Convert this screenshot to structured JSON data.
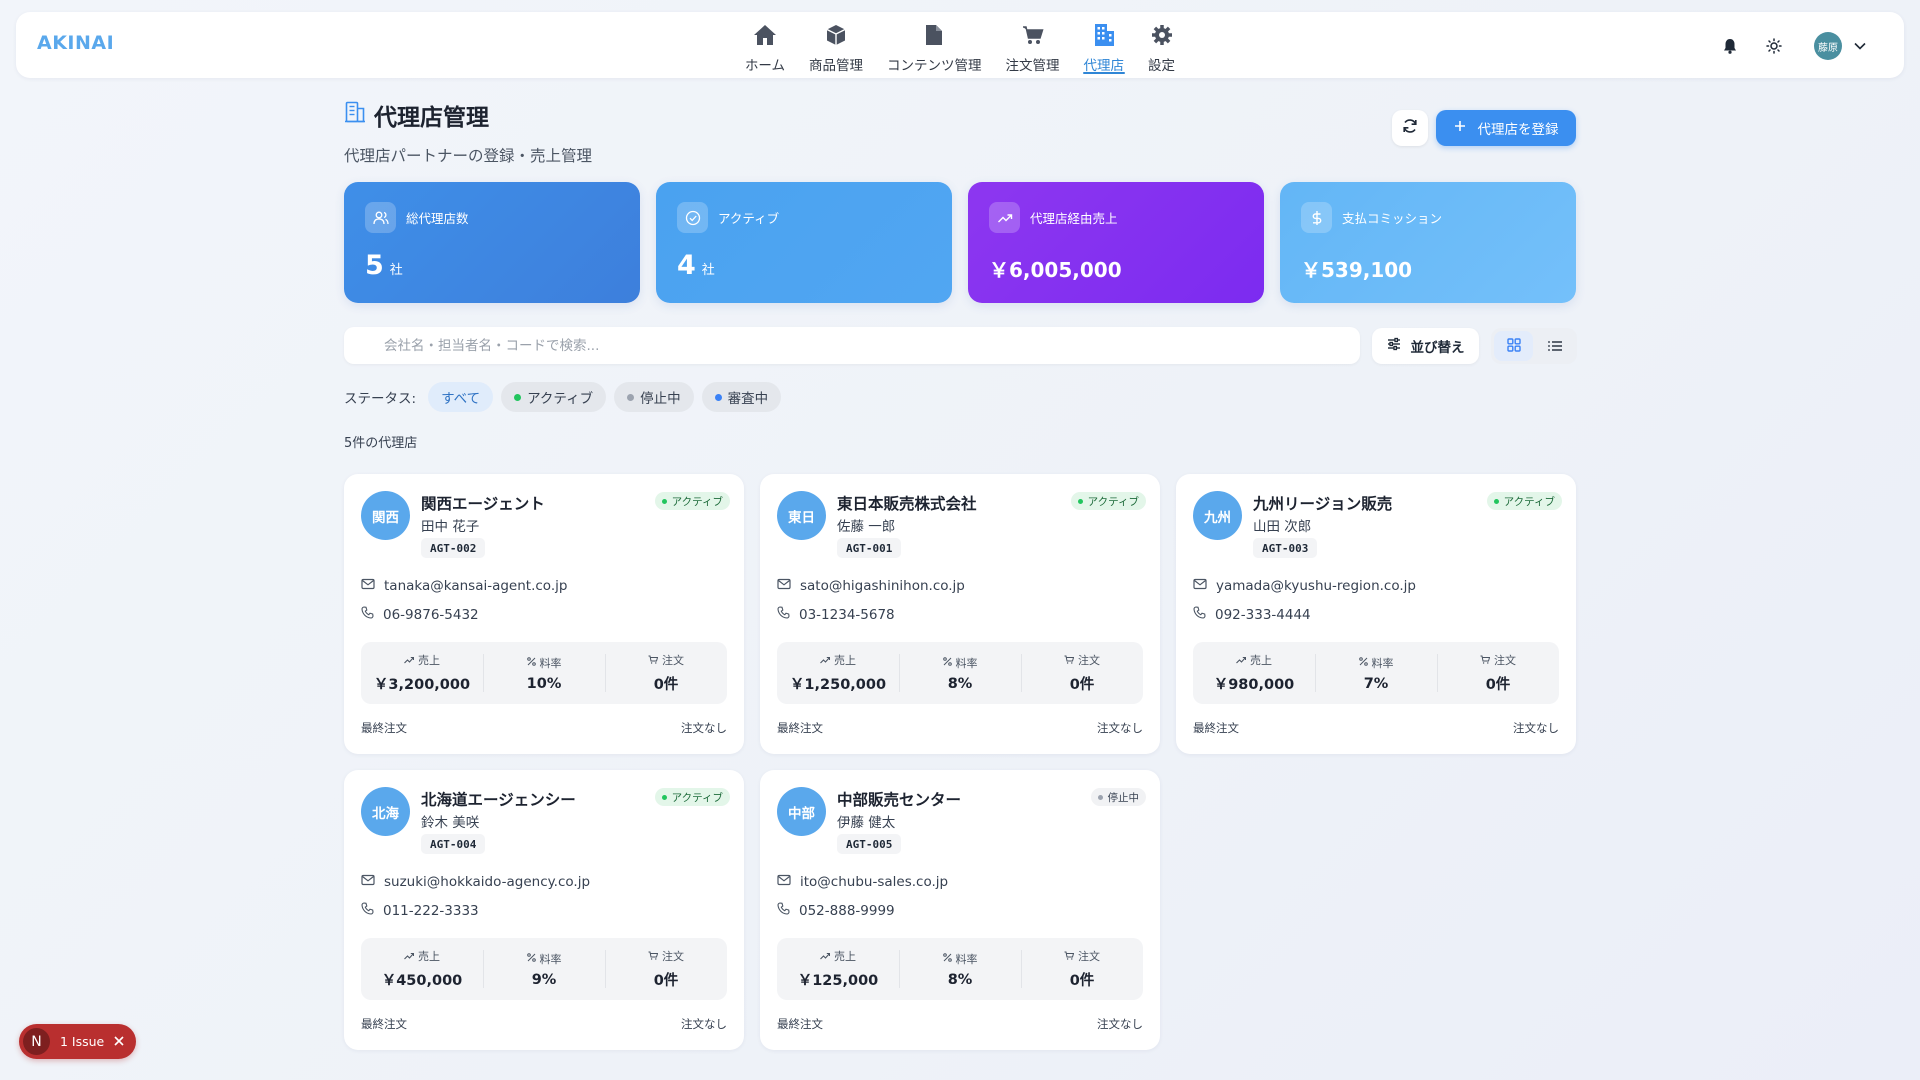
{
  "nav": {
    "brand": "AKINAI",
    "items": [
      {
        "label": "ホーム",
        "icon": "home-icon"
      },
      {
        "label": "商品管理",
        "icon": "box-icon"
      },
      {
        "label": "コンテンツ管理",
        "icon": "file-icon"
      },
      {
        "label": "注文管理",
        "icon": "cart-icon"
      },
      {
        "label": "代理店",
        "icon": "building-icon"
      },
      {
        "label": "設定",
        "icon": "gear-icon"
      }
    ],
    "active_item": "代理店",
    "user_avatar": "藤原"
  },
  "page": {
    "title": "代理店管理",
    "subtitle": "代理店パートナーの登録・売上管理",
    "register_label": "代理店を登録"
  },
  "stats": [
    {
      "label": "総代理店数",
      "value": "5",
      "unit": "社",
      "icon": "users-icon",
      "color_from": "#3f8fe8",
      "color_to": "#3d7fdc"
    },
    {
      "label": "アクティブ",
      "value": "4",
      "unit": "社",
      "icon": "check-circle-icon",
      "color_from": "#4aa2f0",
      "color_to": "#51a6f2"
    },
    {
      "label": "代理店経由売上",
      "value": "￥6,005,000",
      "unit": "",
      "icon": "trending-up-icon",
      "color_from": "#8d37f0",
      "color_to": "#7c2bf0"
    },
    {
      "label": "支払コミッション",
      "value": "￥539,100",
      "unit": "",
      "icon": "dollar-icon",
      "color_from": "#63b6f6",
      "color_to": "#74c0fa"
    }
  ],
  "search": {
    "placeholder": "会社名・担当者名・コードで検索..."
  },
  "sort_label": "並び替え",
  "filters": {
    "label": "ステータス:",
    "chips": [
      {
        "label": "すべて",
        "dot": ""
      },
      {
        "label": "アクティブ",
        "dot": "#22c55e"
      },
      {
        "label": "停止中",
        "dot": "#9ca3af"
      },
      {
        "label": "審査中",
        "dot": "#3b82f6"
      }
    ],
    "active": "すべて"
  },
  "count_text": "5件の代理店",
  "stat_labels": {
    "sales": "売上",
    "rate": "料率",
    "orders": "注文"
  },
  "footer_labels": {
    "last_order": "最終注文",
    "no_order": "注文なし"
  },
  "agencies": [
    {
      "abbr": "関西",
      "name": "関西エージェント",
      "person": "田中 花子",
      "code": "AGT-002",
      "status": "アクティブ",
      "status_type": "active",
      "email": "tanaka@kansai-agent.co.jp",
      "phone": "06-9876-5432",
      "sales": "￥3,200,000",
      "rate": "10%",
      "orders": "0件"
    },
    {
      "abbr": "東日",
      "name": "東日本販売株式会社",
      "person": "佐藤 一郎",
      "code": "AGT-001",
      "status": "アクティブ",
      "status_type": "active",
      "email": "sato@higashinihon.co.jp",
      "phone": "03-1234-5678",
      "sales": "￥1,250,000",
      "rate": "8%",
      "orders": "0件"
    },
    {
      "abbr": "九州",
      "name": "九州リージョン販売",
      "person": "山田 次郎",
      "code": "AGT-003",
      "status": "アクティブ",
      "status_type": "active",
      "email": "yamada@kyushu-region.co.jp",
      "phone": "092-333-4444",
      "sales": "￥980,000",
      "rate": "7%",
      "orders": "0件"
    },
    {
      "abbr": "北海",
      "name": "北海道エージェンシー",
      "person": "鈴木 美咲",
      "code": "AGT-004",
      "status": "アクティブ",
      "status_type": "active",
      "email": "suzuki@hokkaido-agency.co.jp",
      "phone": "011-222-3333",
      "sales": "￥450,000",
      "rate": "9%",
      "orders": "0件"
    },
    {
      "abbr": "中部",
      "name": "中部販売センター",
      "person": "伊藤 健太",
      "code": "AGT-005",
      "status": "停止中",
      "status_type": "paused",
      "email": "ito@chubu-sales.co.jp",
      "phone": "052-888-9999",
      "sales": "￥125,000",
      "rate": "8%",
      "orders": "0件"
    }
  ],
  "issue_badge": {
    "letter": "N",
    "label": "1 Issue"
  }
}
